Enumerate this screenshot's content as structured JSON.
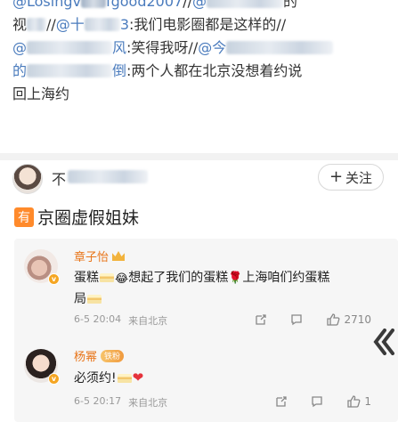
{
  "repost_chain": {
    "line1": {
      "mention_a": "@Losingv",
      "mention_a_tail": "fgood2007",
      "sep": "//",
      "mention_b": "@",
      "tail": "的"
    },
    "line2": {
      "prefix": "视",
      "sep": "//",
      "mention": "@十",
      "suffix_mention": "3",
      "text": ":我们电影圈都是这样的",
      "end": "//"
    },
    "line3": {
      "mention": "@",
      "suffix_mention": "风",
      "text": ":笑得我呀",
      "sep": "//",
      "mention_b": "@今"
    },
    "line4": {
      "prefix_mention": "的",
      "suffix_mention": "倒",
      "text": ":两个人都在北京没想着约说"
    },
    "line5": {
      "text": "回上海约"
    }
  },
  "post": {
    "poster_name_visible": "不",
    "follow_label": "关注",
    "tag_char": "有",
    "body_text": "京圈虚假姐妹"
  },
  "comments": [
    {
      "name": "章子怡",
      "text_a": "蛋糕",
      "text_b": "想起了我们的蛋糕",
      "text_c": "上海咱们约蛋糕",
      "text_d": "局",
      "time": "6-5 20:04",
      "location": "来自北京",
      "likes": "2710"
    },
    {
      "name": "杨幂",
      "fan_badge": "铁粉",
      "text_a": "必须约!",
      "time": "6-5 20:17",
      "location": "来自北京",
      "likes": "1"
    }
  ],
  "icons": [
    "follow-plus-icon",
    "share-icon",
    "comment-icon",
    "like-icon",
    "collapse-arrow-icon",
    "verified-badge-icon",
    "crown-icon"
  ],
  "colors": {
    "link": "#4a7bbd",
    "name_orange": "#e8751a",
    "tag_orange": "#ff8a2b",
    "card_bg": "#f6f6f6",
    "heart_red": "#e5323b"
  }
}
